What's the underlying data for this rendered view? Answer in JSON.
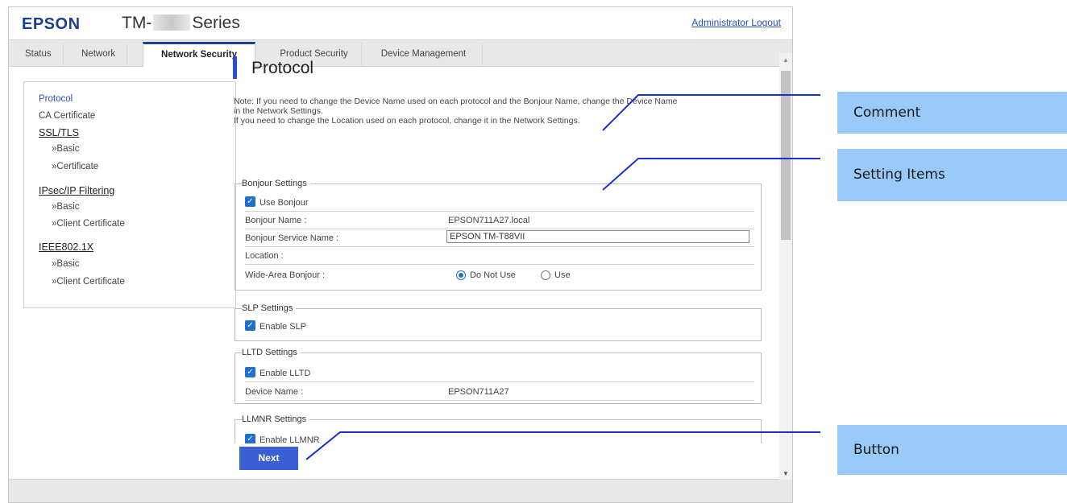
{
  "header": {
    "logo": "EPSON",
    "model_prefix": "TM-",
    "model_suffix": "Series",
    "logout": "Administrator Logout"
  },
  "tabs": [
    {
      "label": "Status"
    },
    {
      "label": "Network"
    },
    {
      "label": "Network Security"
    },
    {
      "label": "Product Security"
    },
    {
      "label": "Device Management"
    }
  ],
  "nav": {
    "protocol": "Protocol",
    "ca_certificate": "CA Certificate",
    "ssl_tls": "SSL/TLS",
    "ssl_basic": "»Basic",
    "ssl_certificate": "»Certificate",
    "ipsec": "IPsec/IP Filtering",
    "ipsec_basic": "»Basic",
    "ipsec_client_cert": "»Client Certificate",
    "ieee": "IEEE802.1X",
    "ieee_basic": "»Basic",
    "ieee_client_cert": "»Client Certificate"
  },
  "main": {
    "title": "Protocol",
    "note_line1": "Note: If you need to change the Device Name used on each protocol and the Bonjour Name, change the Device Name",
    "note_line2": "in the Network Settings.",
    "note_line3": "If you need to change the Location used on each protocol, change it in the Network Settings."
  },
  "bonjour": {
    "legend": "Bonjour Settings",
    "use_label": "Use Bonjour",
    "name_label": "Bonjour Name :",
    "name_value": "EPSON711A27.local",
    "service_label": "Bonjour Service Name :",
    "service_value": "EPSON TM-T88VII",
    "location_label": "Location :",
    "wide_label": "Wide-Area Bonjour :",
    "wide_opt1": "Do Not Use",
    "wide_opt2": "Use"
  },
  "slp": {
    "legend": "SLP Settings",
    "enable_label": "Enable SLP"
  },
  "lltd": {
    "legend": "LLTD Settings",
    "enable_label": "Enable LLTD",
    "device_label": "Device Name :",
    "device_value": "EPSON711A27"
  },
  "llmnr": {
    "legend": "LLMNR Settings",
    "enable_label": "Enable LLMNR"
  },
  "next_button": "Next",
  "callouts": {
    "comment": "Comment",
    "setting_items": "Setting Items",
    "button": "Button"
  },
  "colors": {
    "brand": "#1c3f94",
    "accent_bar": "#2c4bd6",
    "button": "#3a5ed4",
    "callout_bg": "#99c9f7",
    "callout_line": "#1a2fd1"
  }
}
